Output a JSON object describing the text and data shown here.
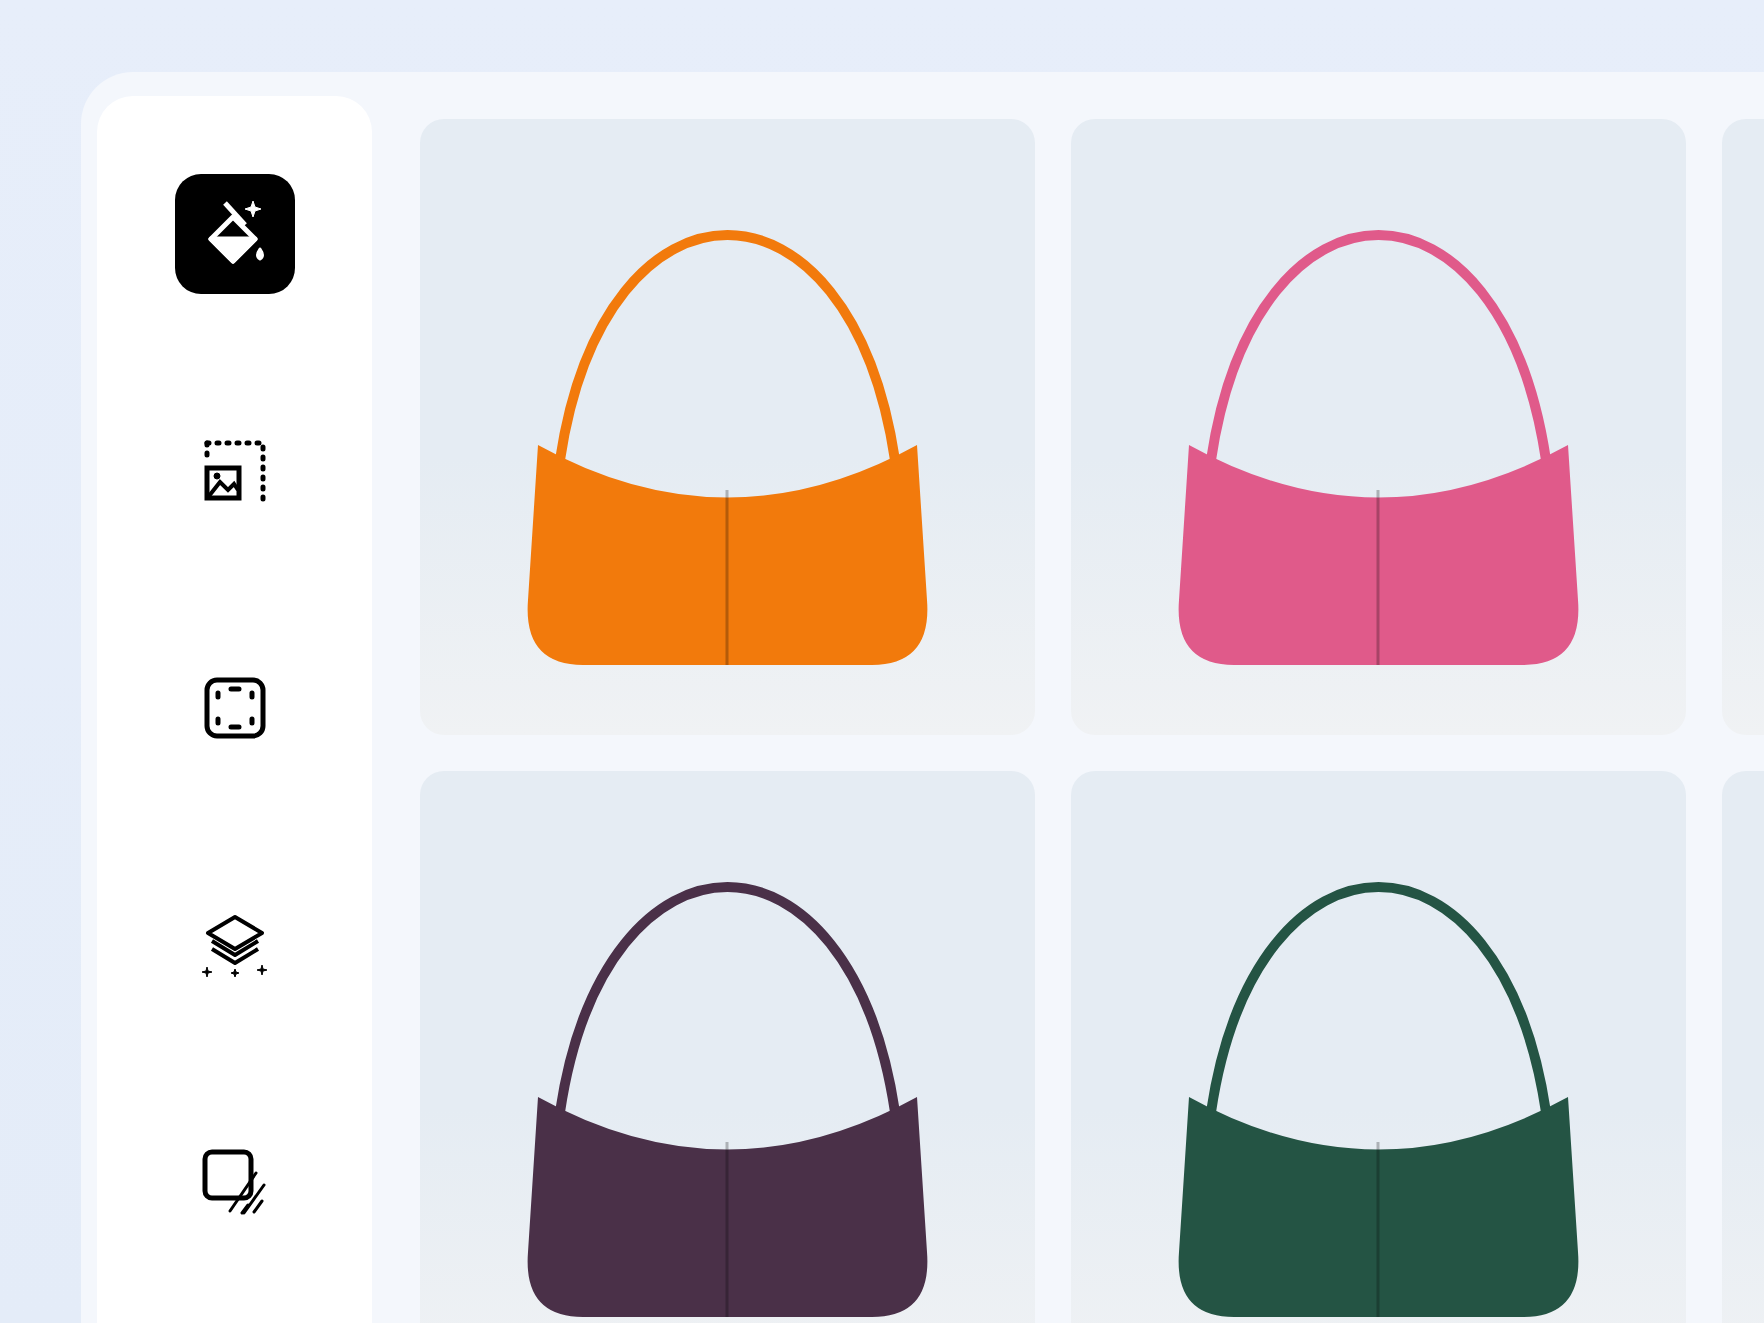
{
  "sidebar": {
    "tools": [
      {
        "kind": "paint-bucket",
        "selected": true
      },
      {
        "kind": "image-selection",
        "selected": false
      },
      {
        "kind": "focus-frame",
        "selected": false
      },
      {
        "kind": "layers",
        "selected": false
      },
      {
        "kind": "square-shadow",
        "selected": false
      }
    ]
  },
  "gallery": {
    "items": [
      {
        "kind": "bag",
        "color": "#f27a0c"
      },
      {
        "kind": "bag",
        "color": "#e05a8a"
      },
      {
        "kind": "cut-off"
      },
      {
        "kind": "bag",
        "color": "#4a3048"
      },
      {
        "kind": "bag",
        "color": "#245444"
      },
      {
        "kind": "cut-off"
      }
    ]
  }
}
